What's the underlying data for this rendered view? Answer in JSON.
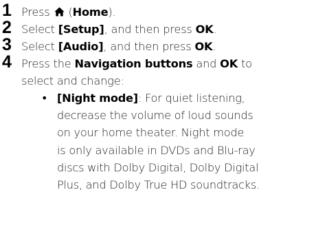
{
  "steps": [
    {
      "number": "1",
      "parts": {
        "pre": "Press",
        "icon": "home-icon",
        "open": "(",
        "bold": "Home",
        "close": ")."
      }
    },
    {
      "number": "2",
      "parts": {
        "pre": "Select",
        "bold1": "[Setup]",
        "mid": ", and then press",
        "bold2": "OK",
        "end": "."
      }
    },
    {
      "number": "3",
      "parts": {
        "pre": "Select",
        "bold1": "[Audio]",
        "mid": ", and then press",
        "bold2": "OK",
        "end": "."
      }
    },
    {
      "number": "4",
      "parts": {
        "pre": "Press the",
        "bold1": "Navigation buttons",
        "mid": "and",
        "bold2": "OK",
        "end": "to",
        "line2": "select and change:"
      }
    }
  ],
  "sub_item": {
    "bullet": "•",
    "term": "[Night mode]",
    "lines": [
      ": For quiet listening,",
      "decrease the volume of loud sounds",
      "on your home theater. Night mode",
      "is only available in DVDs and Blu-ray",
      "discs with Dolby Digital, Dolby Digital",
      "Plus, and Dolby True HD soundtracks."
    ]
  },
  "colors": {
    "text": "#222222",
    "number": "#000000"
  }
}
